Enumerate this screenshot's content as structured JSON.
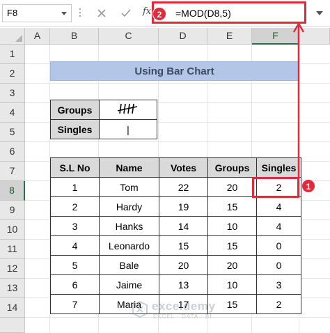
{
  "name_box": "F8",
  "formula_bar": {
    "fx_label": "fx",
    "formula": "=MOD(D8,5)"
  },
  "badges": {
    "formula": "2",
    "cell": "1"
  },
  "columns": [
    "A",
    "B",
    "C",
    "D",
    "E",
    "F"
  ],
  "rows": [
    "1",
    "2",
    "3",
    "4",
    "5",
    "6",
    "7",
    "8",
    "9",
    "10",
    "11",
    "12",
    "13",
    "14"
  ],
  "active_cell": {
    "column": "F",
    "row": "8"
  },
  "title": "Using Bar Chart",
  "tally": {
    "groups_label": "Groups",
    "groups_mark": "||||",
    "singles_label": "Singles",
    "singles_mark": "|"
  },
  "table": {
    "headers": [
      "S.L No",
      "Name",
      "Votes",
      "Groups",
      "Singles"
    ],
    "rows": [
      [
        "1",
        "Tom",
        "22",
        "20",
        "2"
      ],
      [
        "2",
        "Hardy",
        "19",
        "15",
        "4"
      ],
      [
        "3",
        "Hanks",
        "14",
        "10",
        "4"
      ],
      [
        "4",
        "Leonardo",
        "15",
        "15",
        "0"
      ],
      [
        "5",
        "Bale",
        "20",
        "20",
        "0"
      ],
      [
        "6",
        "Jaime",
        "13",
        "10",
        "3"
      ],
      [
        "7",
        "Maria",
        "17",
        "15",
        "2"
      ]
    ]
  },
  "watermark": {
    "name": "exceldemy",
    "tagline": "EXCEL · DATA · BI"
  },
  "colors": {
    "highlight": "#e02b3c",
    "title_fill": "#b4c6e7",
    "header_fill": "#d9d9d9",
    "excel_green": "#217346"
  }
}
